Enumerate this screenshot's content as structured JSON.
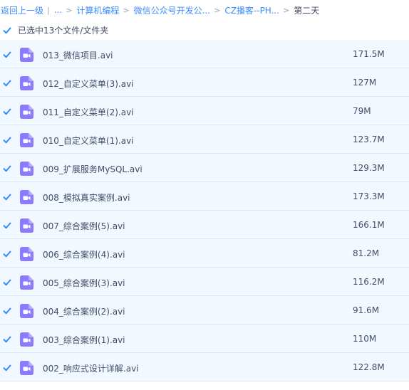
{
  "breadcrumb": {
    "back": "返回上一级",
    "ellipsis": "...",
    "items": [
      "计算机编程",
      "微信公众号开发公...",
      "CZ播客--PH..."
    ],
    "current": "第二天"
  },
  "selection": {
    "text": "已选中13个文件/文件夹"
  },
  "files": [
    {
      "name": "013_微信项目.avi",
      "size": "171.5M"
    },
    {
      "name": "012_自定义菜单(3).avi",
      "size": "127M"
    },
    {
      "name": "011_自定义菜单(2).avi",
      "size": "79M"
    },
    {
      "name": "010_自定义菜单(1).avi",
      "size": "123.7M"
    },
    {
      "name": "009_扩展服务MySQL.avi",
      "size": "129.3M"
    },
    {
      "name": "008_模拟真实案例.avi",
      "size": "173.3M"
    },
    {
      "name": "007_综合案例(5).avi",
      "size": "166.1M"
    },
    {
      "name": "006_综合案例(4).avi",
      "size": "81.2M"
    },
    {
      "name": "005_综合案例(3).avi",
      "size": "116.2M"
    },
    {
      "name": "004_综合案例(2).avi",
      "size": "91.6M"
    },
    {
      "name": "003_综合案例(1).avi",
      "size": "110M"
    },
    {
      "name": "002_响应式设计详解.avi",
      "size": "122.8M"
    }
  ],
  "colors": {
    "link": "#3b8cff",
    "row_bg": "#f2f8ff",
    "check": "#2f8cff",
    "video_icon": "#8d7bff"
  },
  "icons": {
    "row_icon": "video-file-icon",
    "checkbox": "checkbox-checked-icon",
    "separator": "chevron-right-icon"
  }
}
